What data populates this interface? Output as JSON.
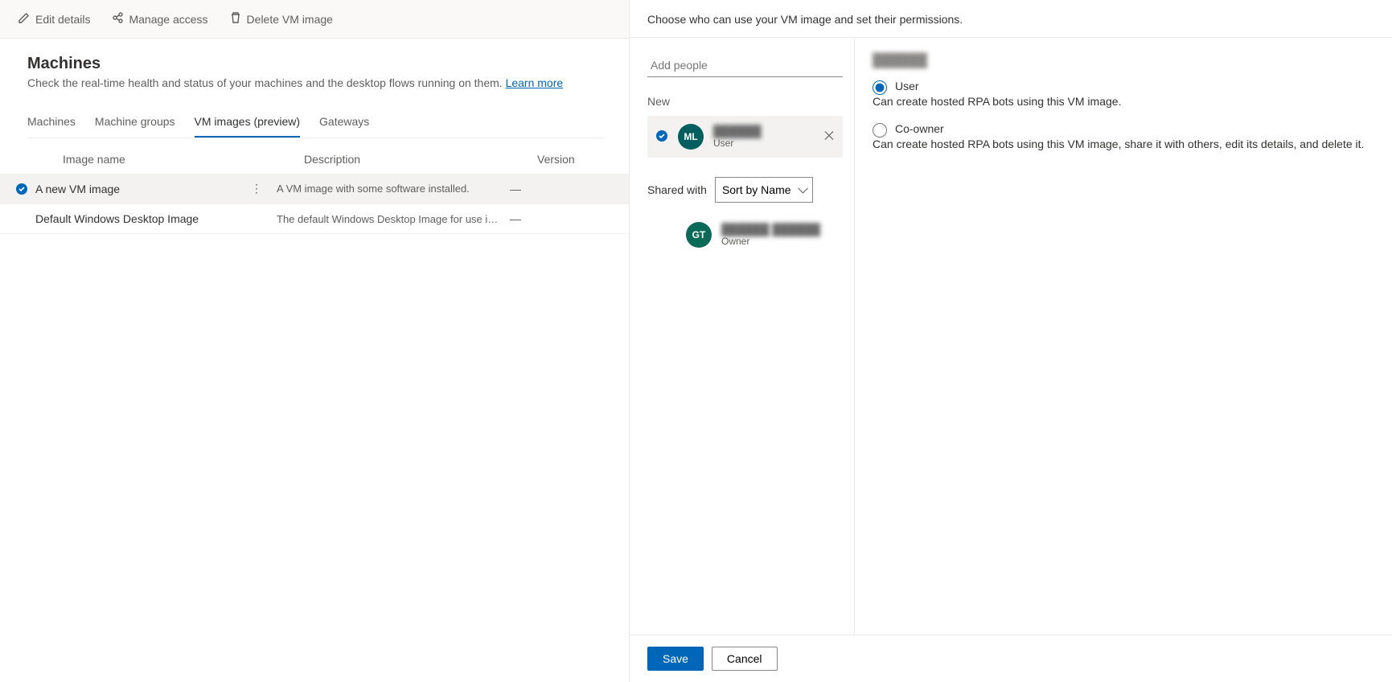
{
  "commandBar": {
    "edit": "Edit details",
    "manage": "Manage access",
    "delete": "Delete VM image"
  },
  "page": {
    "title": "Machines",
    "subtitle_prefix": "Check the real-time health and status of your machines and the desktop flows running on them. ",
    "learn_more": "Learn more"
  },
  "tabs": {
    "machines": "Machines",
    "groups": "Machine groups",
    "vm": "VM images (preview)",
    "gateways": "Gateways",
    "active": "vm"
  },
  "table": {
    "headers": {
      "name": "Image name",
      "desc": "Description",
      "version": "Version"
    },
    "rows": [
      {
        "name": "A new VM image",
        "desc": "A VM image with some software installed.",
        "version": "—",
        "selected": true
      },
      {
        "name": "Default Windows Desktop Image",
        "desc": "The default Windows Desktop Image for use in the Product …",
        "version": "—",
        "selected": false
      }
    ]
  },
  "panel": {
    "intro": "Choose who can use your VM image and set their permissions.",
    "add_placeholder": "Add people",
    "new_label": "New",
    "new_person": {
      "initials": "ML",
      "name": "██████",
      "role": "User"
    },
    "shared_label": "Shared with",
    "sort_value": "Sort by Name",
    "shared_person": {
      "initials": "GT",
      "name": "██████ ██████",
      "role": "Owner"
    },
    "perm_header": "██████",
    "perm": {
      "user": {
        "label": "User",
        "desc": "Can create hosted RPA bots using this VM image."
      },
      "coowner": {
        "label": "Co-owner",
        "desc": "Can create hosted RPA bots using this VM image, share it with others, edit its details, and delete it."
      },
      "selected": "user"
    },
    "save": "Save",
    "cancel": "Cancel"
  }
}
